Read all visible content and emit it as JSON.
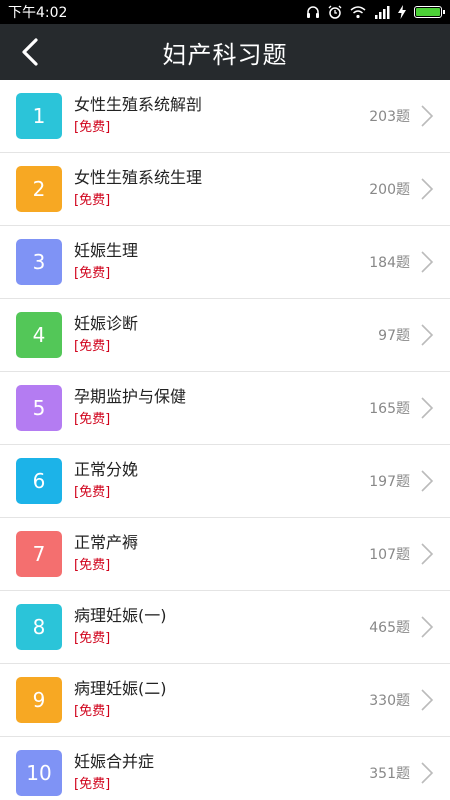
{
  "status_bar": {
    "time": "下午4:02"
  },
  "header": {
    "title": "妇产科习题"
  },
  "items": [
    {
      "num": "1",
      "title": "女性生殖系统解剖",
      "tag": "[免费]",
      "count": "203题",
      "color": "#2bc4d9"
    },
    {
      "num": "2",
      "title": "女性生殖系统生理",
      "tag": "[免费]",
      "count": "200题",
      "color": "#f7a823"
    },
    {
      "num": "3",
      "title": "妊娠生理",
      "tag": "[免费]",
      "count": "184题",
      "color": "#7f93f5"
    },
    {
      "num": "4",
      "title": "妊娠诊断",
      "tag": "[免费]",
      "count": "97题",
      "color": "#53c758"
    },
    {
      "num": "5",
      "title": "孕期监护与保健",
      "tag": "[免费]",
      "count": "165题",
      "color": "#b47cf2"
    },
    {
      "num": "6",
      "title": "正常分娩",
      "tag": "[免费]",
      "count": "197题",
      "color": "#1cb3e8"
    },
    {
      "num": "7",
      "title": "正常产褥",
      "tag": "[免费]",
      "count": "107题",
      "color": "#f46f6f"
    },
    {
      "num": "8",
      "title": "病理妊娠(一)",
      "tag": "[免费]",
      "count": "465题",
      "color": "#2bc4d9"
    },
    {
      "num": "9",
      "title": "病理妊娠(二)",
      "tag": "[免费]",
      "count": "330题",
      "color": "#f7a823"
    },
    {
      "num": "10",
      "title": "妊娠合并症",
      "tag": "[免费]",
      "count": "351题",
      "color": "#7f93f5"
    }
  ]
}
